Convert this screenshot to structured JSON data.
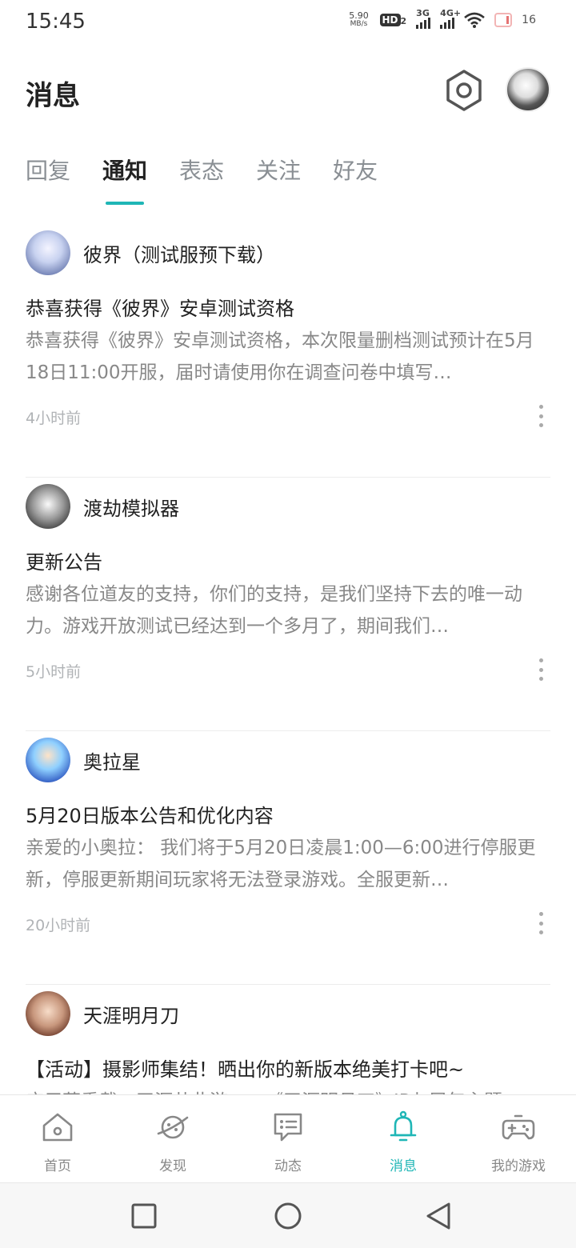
{
  "status_bar": {
    "time": "15:45",
    "net_speed_value": "5.90",
    "net_speed_unit": "MB/s",
    "hd_label": "HD",
    "hd_sub": "2",
    "signal1_label": "3G",
    "signal2_label": "4G+",
    "battery_level": "16"
  },
  "header": {
    "title": "消息",
    "settings_icon": "hexagon-gear-icon",
    "avatar_icon": "user-avatar"
  },
  "tabs": [
    {
      "label": "回复",
      "active": false
    },
    {
      "label": "通知",
      "active": true
    },
    {
      "label": "表态",
      "active": false
    },
    {
      "label": "关注",
      "active": false
    },
    {
      "label": "好友",
      "active": false
    }
  ],
  "notifications": [
    {
      "source": "彼界（测试服预下载）",
      "title": "恭喜获得《彼界》安卓测试资格",
      "body": "恭喜获得《彼界》安卓测试资格，本次限量删档测试预计在5月18日11:00开服，届时请使用你在调查问卷中填写…",
      "time": "4小时前"
    },
    {
      "source": "渡劫模拟器",
      "title": "更新公告",
      "body": "感谢各位道友的支持，你们的支持，是我们坚持下去的唯一动力。游戏开放测试已经达到一个多月了，期间我们…",
      "time": "5小时前"
    },
    {
      "source": "奥拉星",
      "title": "5月20日版本公告和优化内容",
      "body": "亲爱的小奥拉： 我们将于5月20日凌晨1:00—6:00进行停服更新，停服更新期间玩家将无法登录游戏。全服更新…",
      "time": "20小时前"
    },
    {
      "source": "天涯明月刀",
      "title": "【活动】摄影师集结！晒出你的新版本绝美打卡吧~",
      "body": "应用荣重载，天涯共此游——《天涯明月刀》IP七周年主题",
      "time": ""
    }
  ],
  "bottom_nav": [
    {
      "label": "首页",
      "icon": "home-icon",
      "active": false
    },
    {
      "label": "发现",
      "icon": "planet-icon",
      "active": false
    },
    {
      "label": "动态",
      "icon": "chat-bubble-icon",
      "active": false
    },
    {
      "label": "消息",
      "icon": "bell-icon",
      "active": true
    },
    {
      "label": "我的游戏",
      "icon": "gamepad-icon",
      "active": false
    }
  ],
  "colors": {
    "accent": "#1fb6b6",
    "text_primary": "#222222",
    "text_secondary": "#888888"
  }
}
